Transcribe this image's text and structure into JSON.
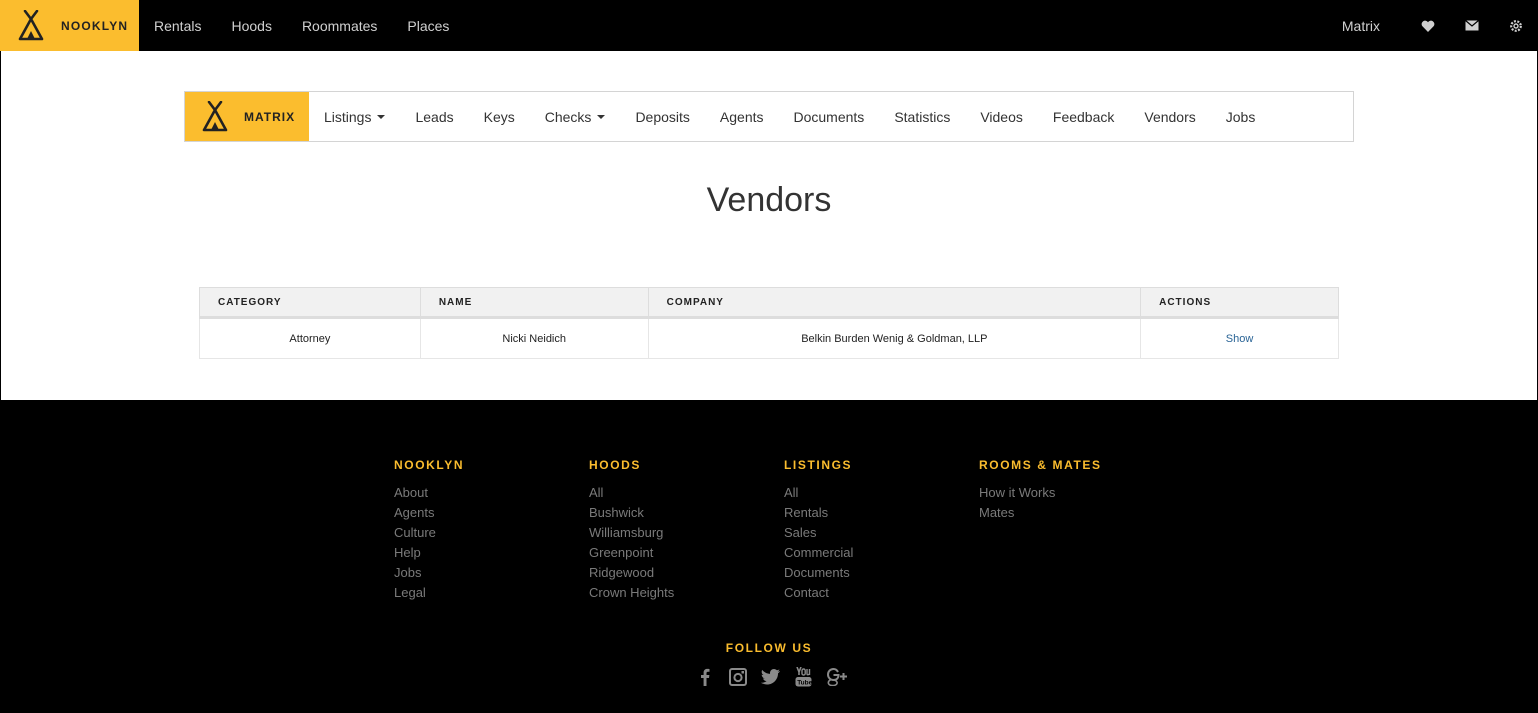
{
  "topbar": {
    "brand": "NOOKLYN",
    "nav": [
      "Rentals",
      "Hoods",
      "Roommates",
      "Places"
    ],
    "right_link": "Matrix",
    "icons": [
      "heart-icon",
      "mail-icon",
      "gear-icon"
    ]
  },
  "subnav": {
    "brand": "MATRIX",
    "items": [
      {
        "label": "Listings",
        "dropdown": true
      },
      {
        "label": "Leads",
        "dropdown": false
      },
      {
        "label": "Keys",
        "dropdown": false
      },
      {
        "label": "Checks",
        "dropdown": true
      },
      {
        "label": "Deposits",
        "dropdown": false
      },
      {
        "label": "Agents",
        "dropdown": false
      },
      {
        "label": "Documents",
        "dropdown": false
      },
      {
        "label": "Statistics",
        "dropdown": false
      },
      {
        "label": "Videos",
        "dropdown": false
      },
      {
        "label": "Feedback",
        "dropdown": false
      },
      {
        "label": "Vendors",
        "dropdown": false
      },
      {
        "label": "Jobs",
        "dropdown": false
      }
    ]
  },
  "page": {
    "title": "Vendors"
  },
  "table": {
    "headers": [
      "CATEGORY",
      "NAME",
      "COMPANY",
      "ACTIONS"
    ],
    "rows": [
      {
        "category": "Attorney",
        "name": "Nicki Neidich",
        "company": "Belkin Burden Wenig & Goldman, LLP",
        "action": "Show"
      }
    ]
  },
  "footer": {
    "columns": [
      {
        "heading": "NOOKLYN",
        "links": [
          "About",
          "Agents",
          "Culture",
          "Help",
          "Jobs",
          "Legal"
        ]
      },
      {
        "heading": "HOODS",
        "links": [
          "All",
          "Bushwick",
          "Williamsburg",
          "Greenpoint",
          "Ridgewood",
          "Crown Heights"
        ]
      },
      {
        "heading": "LISTINGS",
        "links": [
          "All",
          "Rentals",
          "Sales",
          "Commercial",
          "Documents",
          "Contact"
        ]
      },
      {
        "heading": "ROOMS & MATES",
        "links": [
          "How it Works",
          "Mates"
        ]
      }
    ],
    "follow": "FOLLOW US",
    "social_icons": [
      "facebook-icon",
      "instagram-icon",
      "twitter-icon",
      "youtube-icon",
      "google-plus-icon"
    ]
  },
  "colors": {
    "accent": "#fbbd2e",
    "dark": "#000000",
    "link": "#2a6496"
  }
}
